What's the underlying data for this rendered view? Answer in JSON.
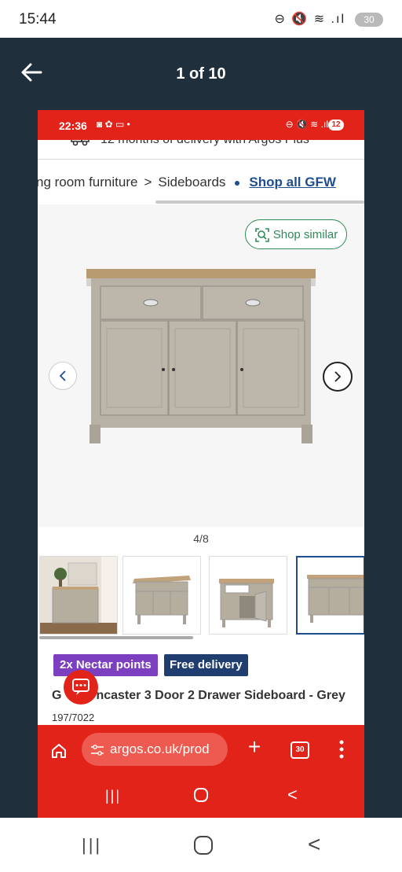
{
  "outer_status": {
    "time": "15:44",
    "icons": "⊖ 🔇 ≋ .ıl",
    "battery": "30"
  },
  "viewer": {
    "counter": "1 of 10"
  },
  "inner_status": {
    "time": "22:36",
    "icons_left": "◙ ✿ ▭ •",
    "icons_right": "⊖ 🔇 ≋ .ıl",
    "battery": "12"
  },
  "delivery": {
    "text": "12 months of delivery with Argos Plus"
  },
  "breadcrumb": {
    "item1": "ng room furniture",
    "separator": ">",
    "item2": "Sideboards",
    "link": "Shop all GFW"
  },
  "gallery": {
    "shop_similar": "Shop similar",
    "counter": "4/8"
  },
  "badges": {
    "nectar": "2x Nectar points",
    "delivery": "Free delivery"
  },
  "product": {
    "title": "GFW Lancaster 3 Door 2 Drawer Sideboard - Grey",
    "title_visible_start": "G",
    "title_visible_rest": "ncaster 3 Door 2 Drawer Sideboard - Grey",
    "code": "197/7022"
  },
  "browser": {
    "url": "argos.co.uk/prod",
    "tabs_count": "30",
    "plus": "+"
  },
  "colors": {
    "argos_red": "#e2231a",
    "viewer_bg": "#1f2f3c",
    "nectar_purple": "#7b3fbf",
    "delivery_navy": "#1f3d6f",
    "link_blue": "#1f4d8f",
    "shop_similar_green": "#2e8b57"
  },
  "icons": [
    "back-arrow-icon",
    "truck-icon",
    "camera-search-icon",
    "chevron-left-icon",
    "chevron-right-icon",
    "chat-icon",
    "home-icon",
    "tune-icon",
    "more-vertical-icon"
  ]
}
